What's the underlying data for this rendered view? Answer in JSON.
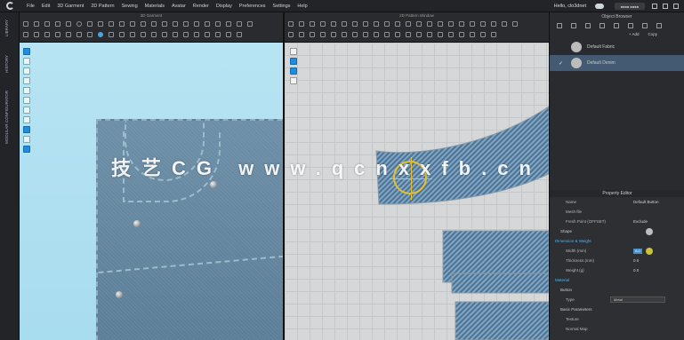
{
  "menu": {
    "items": [
      "File",
      "Edit",
      "3D Garment",
      "2D Pattern",
      "Sewing",
      "Materials",
      "Avatar",
      "Render",
      "Display",
      "Preferences",
      "Settings",
      "Help"
    ],
    "user_label": "Hello, clo3dnet",
    "account_label": "■■■■ ■■■■"
  },
  "left_strip": {
    "tabs": [
      "LIBRARY",
      "HISTORY",
      "MODULAR CONFIGURATOR"
    ]
  },
  "panes": {
    "pane_3d_title": "3D Garment",
    "pane_2d_title": "2D Pattern Window"
  },
  "object_browser": {
    "title": "Object Browser",
    "add_label": "+ Add",
    "copy_label": "Copy",
    "fabrics": [
      {
        "name": "Default Fabric",
        "selected": false
      },
      {
        "name": "Default Denim",
        "selected": true
      }
    ]
  },
  "property_editor": {
    "title": "Property Editor",
    "rows": [
      {
        "label": "Name",
        "value": "Default Button",
        "kind": "row"
      },
      {
        "label": "Mesh file",
        "value": "",
        "kind": "row"
      },
      {
        "label": "Fresh Point (OFFSET)",
        "value": "Exclude",
        "kind": "row"
      },
      {
        "label": "Shape",
        "value": "",
        "kind": "shape"
      },
      {
        "label": "Dimension & Weight",
        "value": "",
        "kind": "section"
      },
      {
        "label": "Width (mm)",
        "value": "8.0",
        "kind": "highlight"
      },
      {
        "label": "Thickness (mm)",
        "value": "0.0",
        "kind": "row"
      },
      {
        "label": "Weight (g)",
        "value": "0.0",
        "kind": "row"
      },
      {
        "label": "Material",
        "value": "",
        "kind": "section"
      },
      {
        "label": "Button",
        "value": "",
        "kind": "sub"
      },
      {
        "label": "Type",
        "value": "Metal",
        "kind": "select"
      },
      {
        "label": "Basic Parameters",
        "value": "",
        "kind": "sub"
      },
      {
        "label": "Texture",
        "value": "",
        "kind": "row"
      },
      {
        "label": "Normal Map",
        "value": "",
        "kind": "row"
      }
    ]
  },
  "watermark": "技艺CG www.qcnxxfb.cn",
  "colors": {
    "accent_blue": "#1f8de0",
    "selection": "#445a72",
    "denim": "#5f86a8",
    "viewport_3d_bg": "#b7e4f3",
    "crosshair": "#e5c02c"
  }
}
